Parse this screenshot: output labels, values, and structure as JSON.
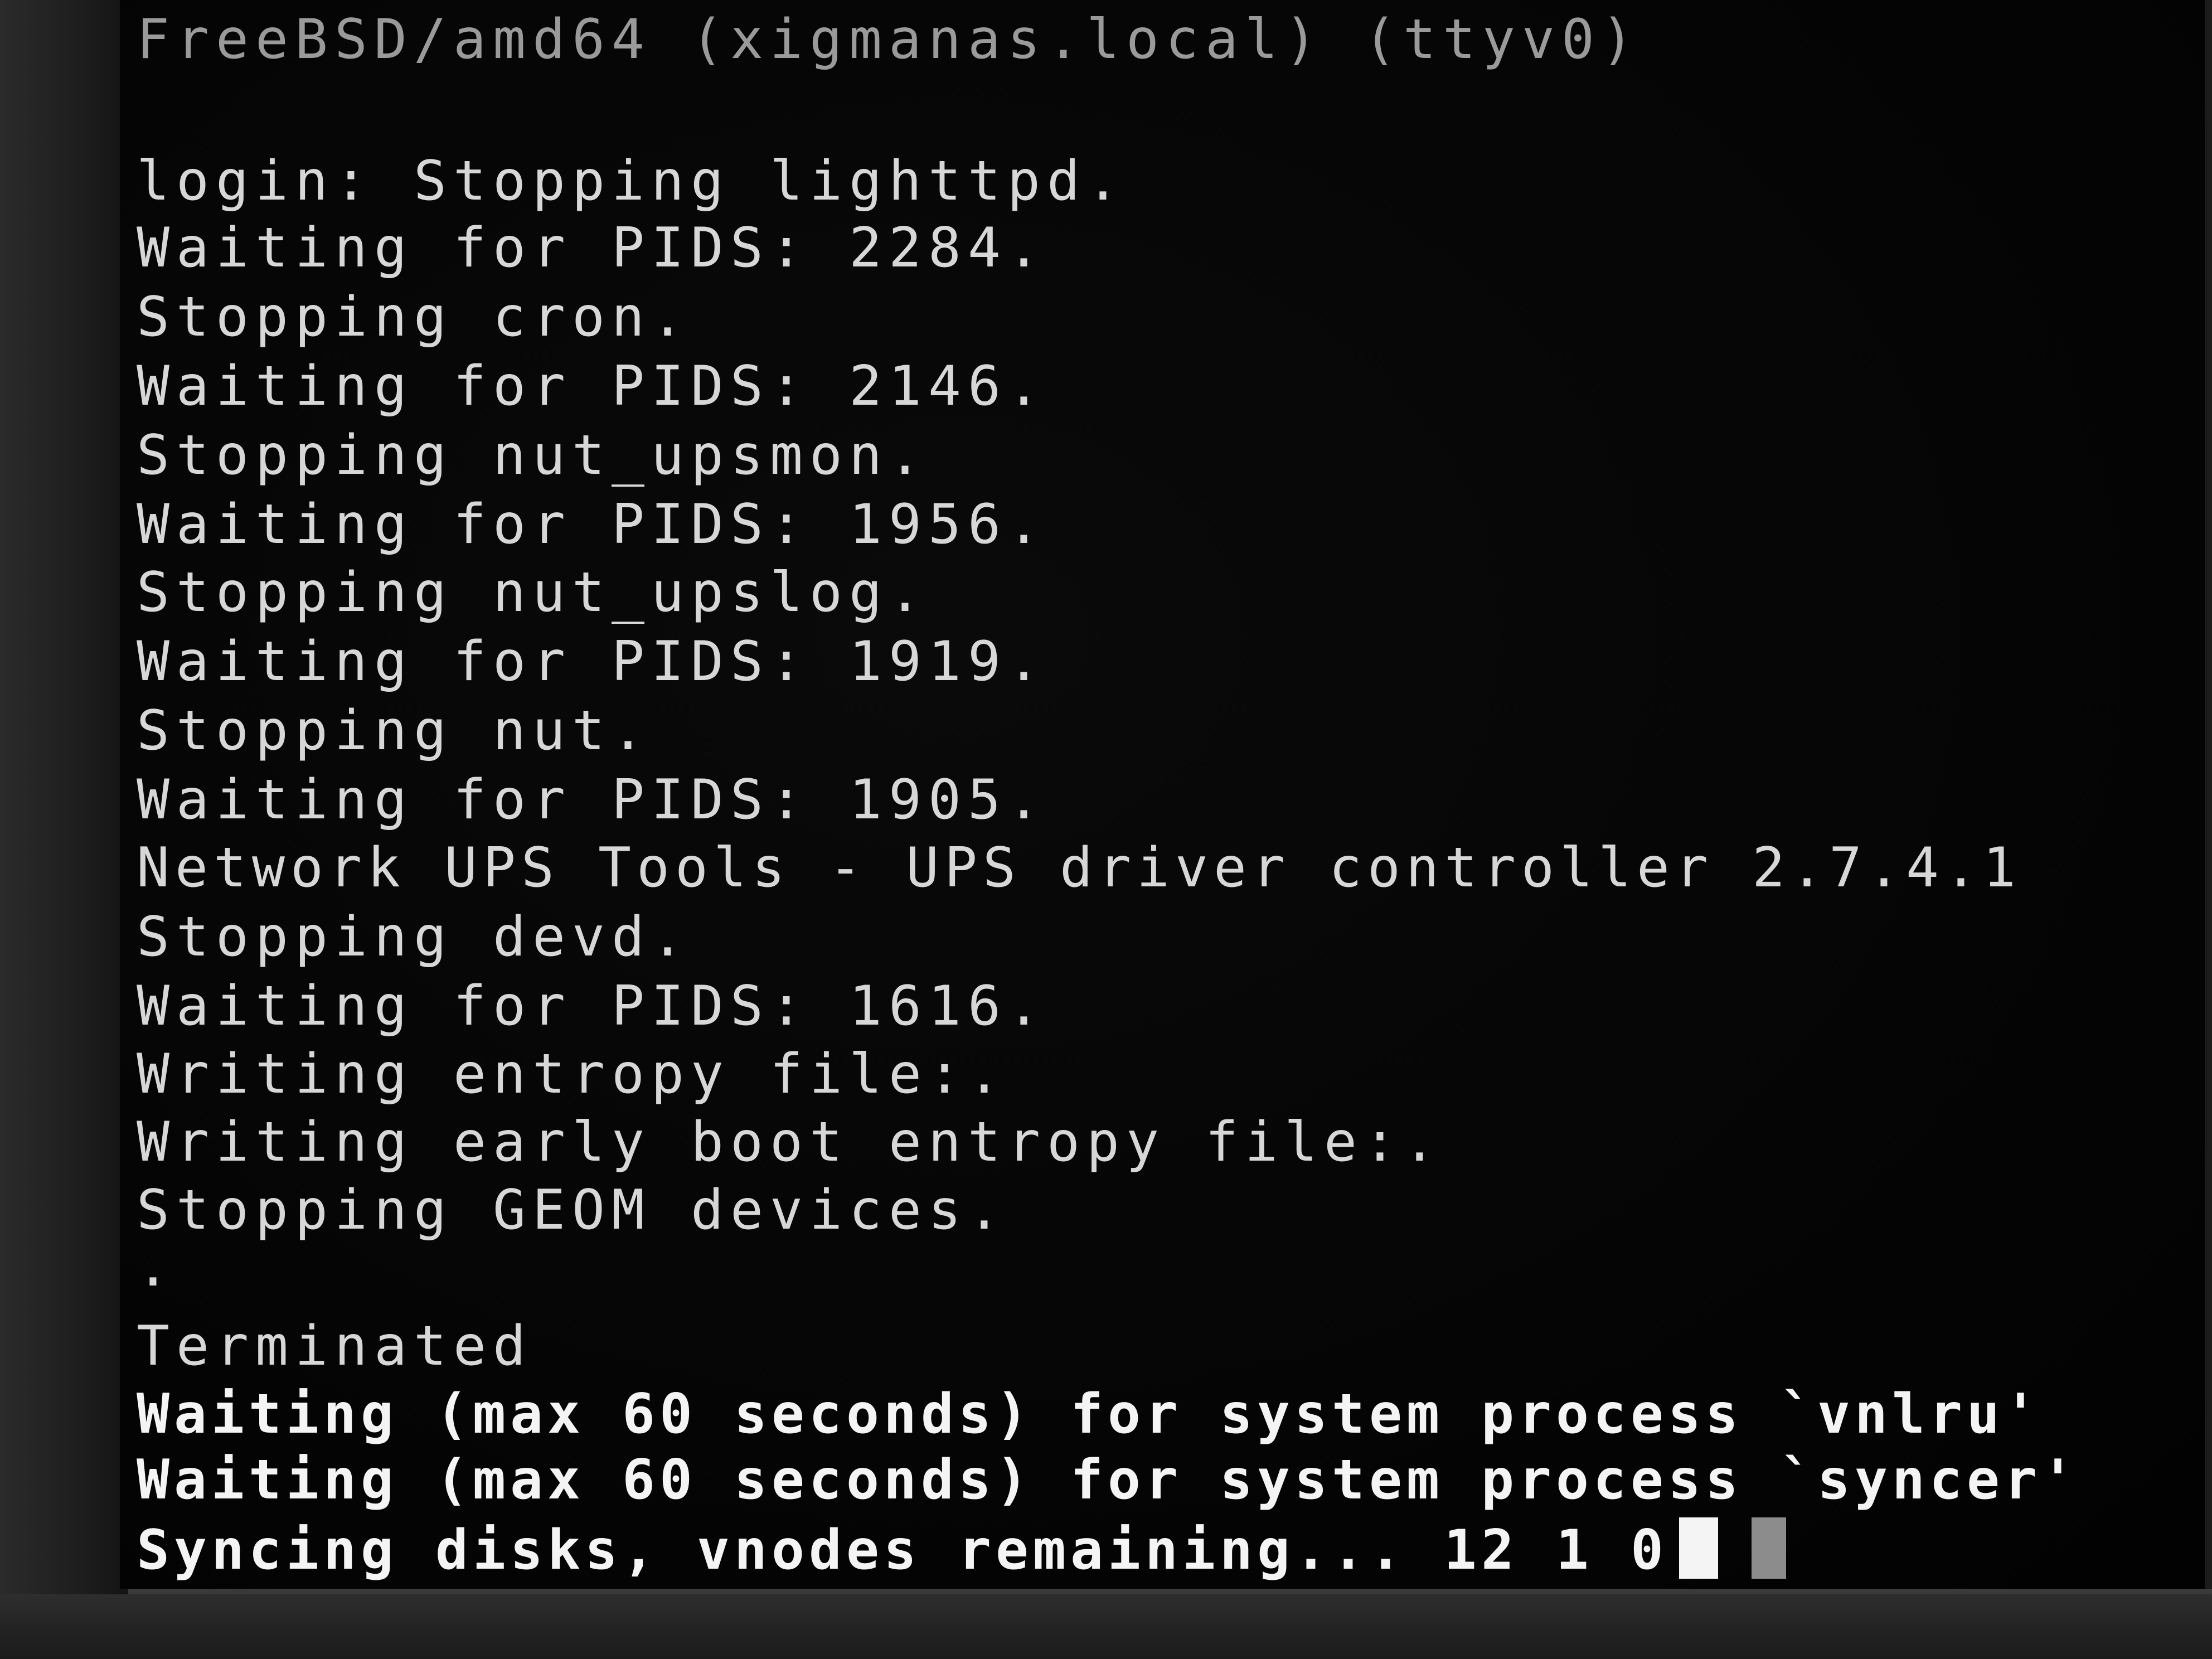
{
  "console": {
    "header": "FreeBSD/amd64 (xigmanas.local) (ttyv0)",
    "lines": [
      "login: Stopping lighttpd.",
      "Waiting for PIDS: 2284.",
      "Stopping cron.",
      "Waiting for PIDS: 2146.",
      "Stopping nut_upsmon.",
      "Waiting for PIDS: 1956.",
      "Stopping nut_upslog.",
      "Waiting for PIDS: 1919.",
      "Stopping nut.",
      "Waiting for PIDS: 1905.",
      "Network UPS Tools - UPS driver controller 2.7.4.1",
      "Stopping devd.",
      "Waiting for PIDS: 1616.",
      "Writing entropy file:.",
      "Writing early boot entropy file:.",
      "Stopping GEOM devices.",
      ".",
      "Terminated"
    ],
    "kernel_lines": [
      "Waiting (max 60 seconds) for system process `vnlru'",
      "Waiting (max 60 seconds) for system process `syncer'",
      "Syncing disks, vnodes remaining... 12 1 0"
    ]
  }
}
